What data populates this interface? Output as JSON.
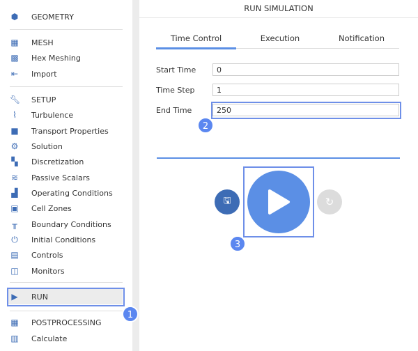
{
  "sidebar": {
    "items": [
      {
        "label": "GEOMETRY",
        "icon": "geometry-icon"
      },
      {
        "label": "MESH",
        "icon": "mesh-icon"
      },
      {
        "label": "Hex Meshing",
        "icon": "hex-meshing-icon"
      },
      {
        "label": "Import",
        "icon": "import-icon"
      },
      {
        "label": "SETUP",
        "icon": "wrench-icon"
      },
      {
        "label": "Turbulence",
        "icon": "turbulence-icon"
      },
      {
        "label": "Transport Properties",
        "icon": "truck-icon"
      },
      {
        "label": "Solution",
        "icon": "gear-icon"
      },
      {
        "label": "Discretization",
        "icon": "discretization-icon"
      },
      {
        "label": "Passive Scalars",
        "icon": "passive-scalars-icon"
      },
      {
        "label": "Operating Conditions",
        "icon": "operating-conditions-icon"
      },
      {
        "label": "Cell Zones",
        "icon": "cell-zones-icon"
      },
      {
        "label": "Boundary Conditions",
        "icon": "boundary-conditions-icon"
      },
      {
        "label": "Initial Conditions",
        "icon": "power-icon"
      },
      {
        "label": "Controls",
        "icon": "controls-icon"
      },
      {
        "label": "Monitors",
        "icon": "monitors-icon"
      },
      {
        "label": "RUN",
        "icon": "play-icon"
      },
      {
        "label": "POSTPROCESSING",
        "icon": "postprocessing-icon"
      },
      {
        "label": "Calculate",
        "icon": "calculator-icon"
      }
    ]
  },
  "main": {
    "title": "RUN SIMULATION",
    "tabs": [
      {
        "label": "Time Control"
      },
      {
        "label": "Execution"
      },
      {
        "label": "Notification"
      }
    ],
    "fields": [
      {
        "label": "Start Time",
        "value": "0"
      },
      {
        "label": "Time Step",
        "value": "1"
      },
      {
        "label": "End Time",
        "value": "250"
      }
    ]
  },
  "badges": [
    "1",
    "2",
    "3"
  ],
  "colors": {
    "accent": "#5b8fe5",
    "icon": "#3d6cb5",
    "save": "#3d6cb5",
    "reset": "#dcdcdc"
  }
}
